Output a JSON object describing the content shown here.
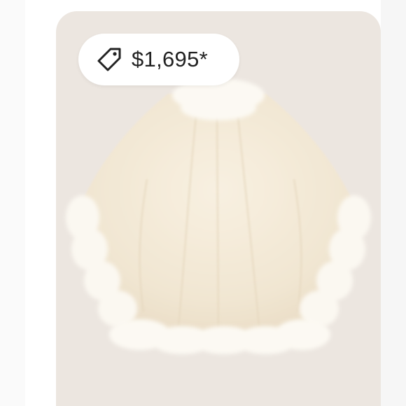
{
  "listing": {
    "price": "$1,695*",
    "price_icon": "tag-icon",
    "image": "cream-cape-with-fur-trim"
  },
  "colors": {
    "card_background": "#ece6e0",
    "pill_background": "#ffffff",
    "price_text": "#222222",
    "garment": "#f3ead9",
    "fur_trim": "#fbf8f1"
  }
}
